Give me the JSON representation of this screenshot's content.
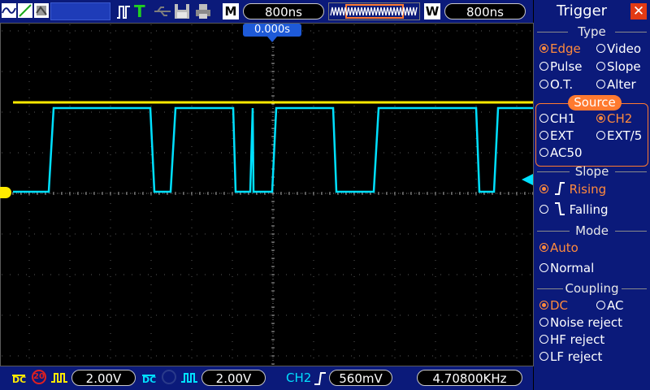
{
  "top_bar": {
    "mode_button": "M",
    "timebase": "800ns",
    "window_button": "W",
    "window_timebase": "800ns",
    "trigger_position": "0.000s"
  },
  "bottom_bar": {
    "ch1": {
      "coupling": "DC",
      "bw_limit": "20",
      "volts_div": "2.00V",
      "color": "#ffea00"
    },
    "ch2": {
      "coupling": "DC",
      "volts_div": "2.00V",
      "color": "#00e0ff"
    },
    "trigger_source": "CH2",
    "trigger_level": "560mV",
    "frequency": "4.70800KHz"
  },
  "trigger_menu": {
    "title": "Trigger",
    "type": {
      "header": "Type",
      "options": [
        "Edge",
        "Video",
        "Pulse",
        "Slope",
        "O.T.",
        "Alter"
      ],
      "selected": "Edge"
    },
    "source": {
      "header": "Source",
      "options": [
        "CH1",
        "CH2",
        "EXT",
        "EXT/5",
        "AC50"
      ],
      "selected": "CH2"
    },
    "slope": {
      "header": "Slope",
      "options": [
        "Rising",
        "Falling"
      ],
      "selected": "Rising"
    },
    "mode": {
      "header": "Mode",
      "options": [
        "Auto",
        "Normal"
      ],
      "selected": "Auto"
    },
    "coupling": {
      "header": "Coupling",
      "options": [
        "DC",
        "AC",
        "Noise reject",
        "HF reject",
        "LF reject"
      ],
      "selected": "DC"
    }
  },
  "waveforms": {
    "ch1_color": "#ffea00",
    "ch2_color": "#00e0ff",
    "grid_color": "#5a5a5a",
    "accent": "#ff7a30"
  }
}
